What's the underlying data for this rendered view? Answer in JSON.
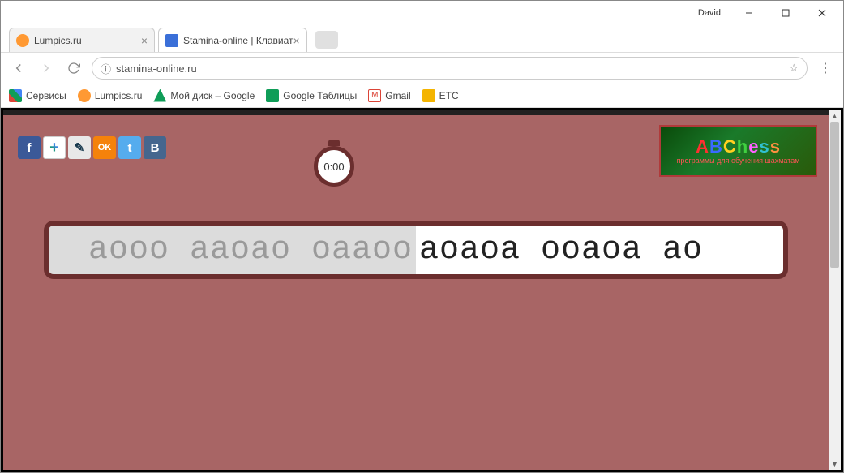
{
  "window": {
    "profile": "David"
  },
  "tabs": [
    {
      "title": "Lumpics.ru",
      "favicon_color": "#ff9933",
      "active": false
    },
    {
      "title": "Stamina-online | Клавиат",
      "favicon_color": "#3a6fd8",
      "active": true
    }
  ],
  "address": {
    "url": "stamina-online.ru"
  },
  "bookmarks": {
    "apps": "Сервисы",
    "items": [
      {
        "label": "Lumpics.ru",
        "color": "#ff9933"
      },
      {
        "label": "Мой диск – Google ",
        "color": "#0f9d58"
      },
      {
        "label": "Google Таблицы",
        "color": "#0f9d58"
      },
      {
        "label": "Gmail",
        "color": "#db4437"
      },
      {
        "label": "ETC",
        "color": "#f4b400"
      }
    ]
  },
  "social": [
    {
      "name": "facebook",
      "bg": "#3b5998",
      "char": "f"
    },
    {
      "name": "google-plus",
      "bg": "#ffffff",
      "char": "+"
    },
    {
      "name": "livejournal",
      "bg": "#e8e8e8",
      "char": "✎"
    },
    {
      "name": "odnoklassniki",
      "bg": "#f5820b",
      "char": "OK"
    },
    {
      "name": "twitter",
      "bg": "#55acee",
      "char": "t"
    },
    {
      "name": "vkontakte",
      "bg": "#45668e",
      "char": "B"
    }
  ],
  "timer": {
    "value": "0:00"
  },
  "ad": {
    "title_letters": [
      "A",
      "B",
      "C",
      "h",
      "e",
      "s",
      "s"
    ],
    "subtitle": "программы для обучения шахматам"
  },
  "typing": {
    "done": "аооо ааоао оааоо",
    "todo": "аоаоа ооаоа ао"
  },
  "colors": {
    "page_bg": "#a86565",
    "typing_frame": "#6b2e2e"
  }
}
